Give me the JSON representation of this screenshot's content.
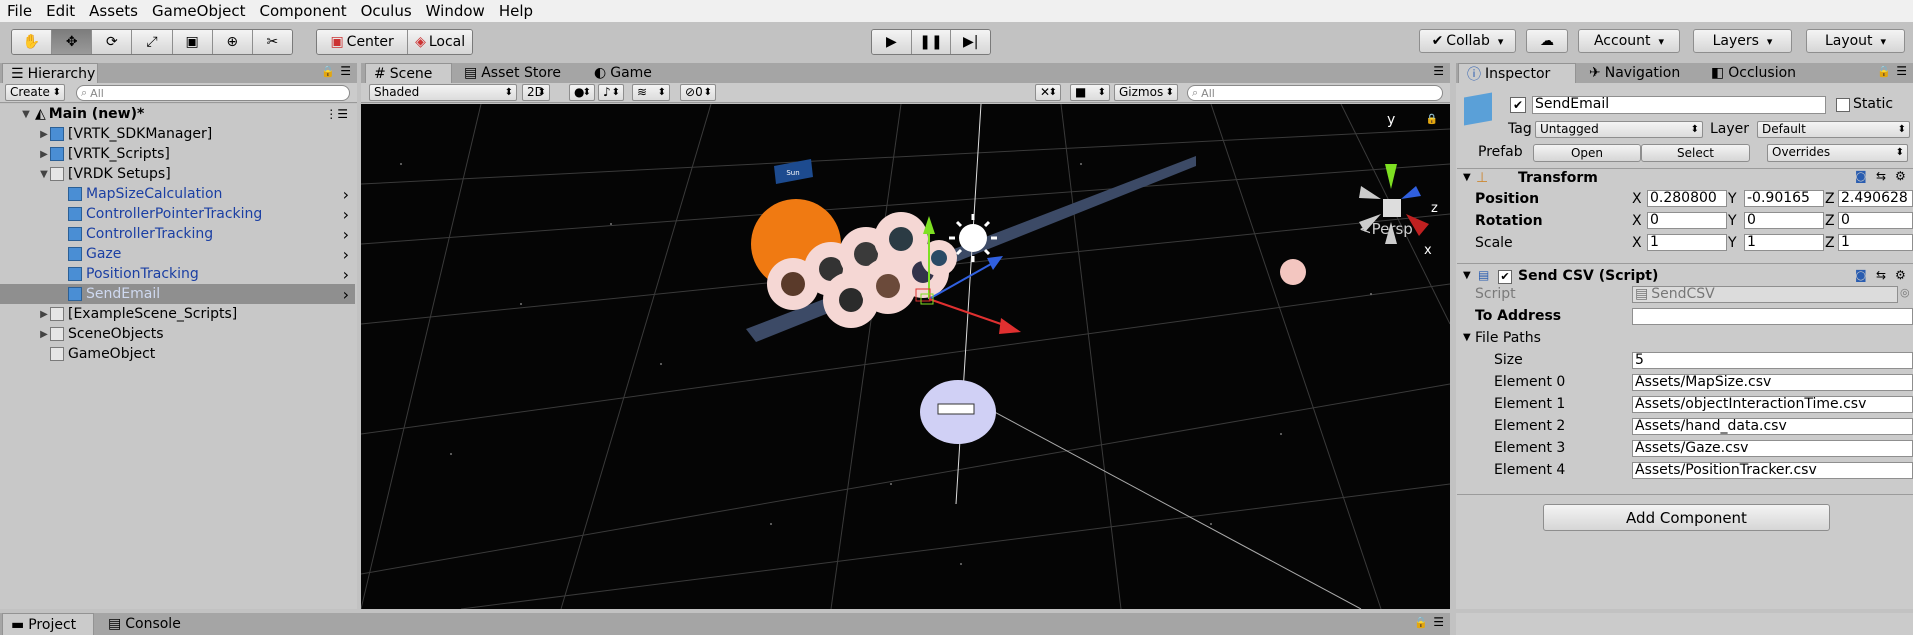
{
  "menu": [
    "File",
    "Edit",
    "Assets",
    "GameObject",
    "Component",
    "Oculus",
    "Window",
    "Help"
  ],
  "toolbar": {
    "pivot_label": "Center",
    "space_label": "Local",
    "collab_label": "Collab",
    "account_label": "Account",
    "layers_label": "Layers",
    "layout_label": "Layout"
  },
  "hierarchy": {
    "tab_label": "Hierarchy",
    "create_label": "Create",
    "search_placeholder": "All",
    "scene_name": "Main (new)*",
    "items": [
      {
        "label": "[VRTK_SDKManager]",
        "indent": 1,
        "arrow": "▶",
        "icon": "cube-blue",
        "style": "normal"
      },
      {
        "label": "[VRTK_Scripts]",
        "indent": 1,
        "arrow": "▶",
        "icon": "cube-blue",
        "style": "normal"
      },
      {
        "label": "[VRDK Setups]",
        "indent": 1,
        "arrow": "▼",
        "icon": "cube-grey",
        "style": "normal"
      },
      {
        "label": "MapSizeCalculation",
        "indent": 2,
        "arrow": "",
        "icon": "cube-blue",
        "style": "prefab"
      },
      {
        "label": "ControllerPointerTracking",
        "indent": 2,
        "arrow": "",
        "icon": "cube-blue",
        "style": "prefab"
      },
      {
        "label": "ControllerTracking",
        "indent": 2,
        "arrow": "",
        "icon": "cube-blue",
        "style": "prefab"
      },
      {
        "label": "Gaze",
        "indent": 2,
        "arrow": "",
        "icon": "cube-blue",
        "style": "prefab"
      },
      {
        "label": "PositionTracking",
        "indent": 2,
        "arrow": "",
        "icon": "cube-blue",
        "style": "prefab"
      },
      {
        "label": "SendEmail",
        "indent": 2,
        "arrow": "",
        "icon": "cube-blue",
        "style": "selected"
      },
      {
        "label": "[ExampleScene_Scripts]",
        "indent": 1,
        "arrow": "▶",
        "icon": "cube-grey",
        "style": "normal"
      },
      {
        "label": "SceneObjects",
        "indent": 1,
        "arrow": "▶",
        "icon": "cube-grey",
        "style": "normal"
      },
      {
        "label": "GameObject",
        "indent": 1,
        "arrow": "",
        "icon": "cube-grey",
        "style": "normal"
      }
    ]
  },
  "scene": {
    "tabs": [
      "Scene",
      "Asset Store",
      "Game"
    ],
    "shading": "Shaded",
    "mode_2d": "2D",
    "hidden_count": "0",
    "gizmos_label": "Gizmos",
    "search_placeholder": "All",
    "persp_label": "<Persp",
    "axis_y": "y",
    "axis_x": "x",
    "axis_z": "z",
    "sign_label": "Sun"
  },
  "inspector": {
    "tabs": [
      "Inspector",
      "Navigation",
      "Occlusion"
    ],
    "object_name": "SendEmail",
    "static_label": "Static",
    "tag_label": "Tag",
    "tag_value": "Untagged",
    "layer_label": "Layer",
    "layer_value": "Default",
    "prefab_label": "Prefab",
    "open_label": "Open",
    "select_label": "Select",
    "overrides_label": "Overrides",
    "transform": {
      "title": "Transform",
      "position_label": "Position",
      "rotation_label": "Rotation",
      "scale_label": "Scale",
      "position": [
        "0.280800",
        "-0.90165",
        "2.490628"
      ],
      "rotation": [
        "0",
        "0",
        "0"
      ],
      "scale": [
        "1",
        "1",
        "1"
      ],
      "x": "X",
      "y": "Y",
      "z": "Z"
    },
    "script_component": {
      "title": "Send CSV (Script)",
      "script_label": "Script",
      "script_value": "SendCSV",
      "to_address_label": "To Address",
      "to_address_value": "",
      "file_paths_label": "File Paths",
      "size_label": "Size",
      "size_value": "5",
      "elements": [
        {
          "label": "Element 0",
          "value": "Assets/MapSize.csv"
        },
        {
          "label": "Element 1",
          "value": "Assets/objectInteractionTime.csv"
        },
        {
          "label": "Element 2",
          "value": "Assets/hand_data.csv"
        },
        {
          "label": "Element 3",
          "value": "Assets/Gaze.csv"
        },
        {
          "label": "Element 4",
          "value": "Assets/PositionTracker.csv"
        }
      ]
    },
    "add_component_label": "Add Component"
  },
  "bottom": {
    "tabs": [
      "Project",
      "Console"
    ]
  },
  "colors": {
    "panel_bg": "#cbcbcb",
    "selection": "#8f8f8f",
    "prefab_blue": "#1b3fa3",
    "scene_bg": "#050505"
  }
}
